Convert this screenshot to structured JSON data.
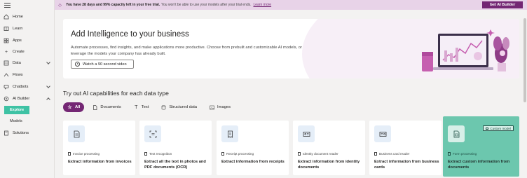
{
  "banner": {
    "strong": "You have 28 days and 99% capacity left in your free trial.",
    "text": "You won't be able to use your models after your trial ends.",
    "link": "Learn more",
    "button": "Get AI Builder"
  },
  "sidebar": {
    "items": [
      {
        "label": "Home",
        "icon": "home-icon"
      },
      {
        "label": "Learn",
        "icon": "book-icon"
      },
      {
        "label": "Apps",
        "icon": "apps-icon"
      },
      {
        "label": "Create",
        "icon": "plus-icon"
      },
      {
        "label": "Data",
        "icon": "database-icon"
      },
      {
        "label": "Flows",
        "icon": "flow-icon"
      },
      {
        "label": "Chatbots",
        "icon": "chatbot-icon"
      },
      {
        "label": "AI Builder",
        "icon": "brain-icon"
      }
    ],
    "sub_items": [
      "Explore",
      "Models"
    ],
    "solutions": "Solutions"
  },
  "hero": {
    "title": "Add Intelligence to your business",
    "description": "Automate processes, find insights, and make applications more productive. Choose from prebuilt and customizable AI models, or leverage the models your company has already built.",
    "video_button": "Watch a 90 second video"
  },
  "section": {
    "title": "Try out AI capabilities for each data type",
    "filters": [
      "All",
      "Documents",
      "Text",
      "Structured data",
      "Images"
    ]
  },
  "cards": [
    {
      "type": "Invoice processing",
      "desc": "Extract information from invoices"
    },
    {
      "type": "Text recognition",
      "desc": "Extract all the text in photos and PDF documents (OCR)"
    },
    {
      "type": "Receipt processing",
      "desc": "Extract information from receipts"
    },
    {
      "type": "Identity document reader",
      "desc": "Extract information from identity documents"
    },
    {
      "type": "Business card reader",
      "desc": "Extract information from business cards"
    },
    {
      "type": "Form processing",
      "desc": "Extract custom information from documents",
      "badge": "Custom model"
    }
  ],
  "colors": {
    "accent": "#742774",
    "explore_active": "#3ec2a4",
    "highlight_card": "#6cc7ae",
    "banner": "#e8d3e8"
  }
}
